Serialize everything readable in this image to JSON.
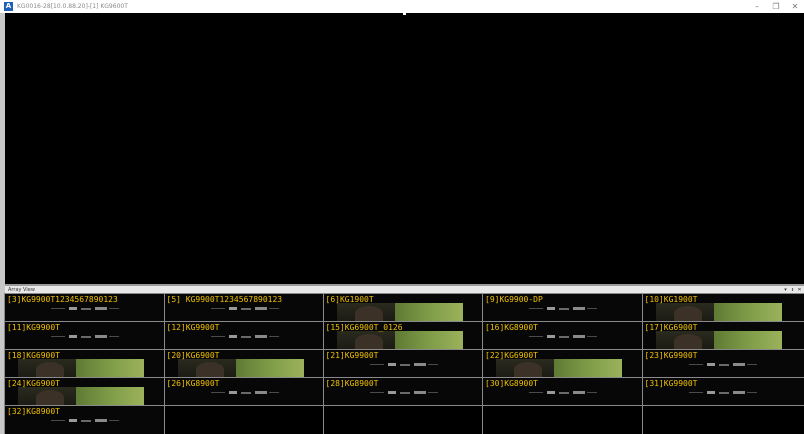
{
  "window": {
    "title": "KG0016-28[10.0.88.20]-[1] KG9600T",
    "app_icon_letter": "A",
    "minimize": "–",
    "maximize": "❐",
    "close": "✕"
  },
  "array_view": {
    "title": "Array View",
    "controls": [
      "▾",
      "ᵻ",
      "✕"
    ]
  },
  "cells": [
    {
      "label": "[3]KG9900T1234567890123",
      "video": false
    },
    {
      "label": "[5] KG9900T1234567890123",
      "video": false
    },
    {
      "label": "[6]KG1900T",
      "video": true
    },
    {
      "label": "[9]KG9900-DP",
      "video": false
    },
    {
      "label": "[10]KG1900T",
      "video": true
    },
    {
      "label": "[11]KG9900T",
      "video": false
    },
    {
      "label": "[12]KG9900T",
      "video": false
    },
    {
      "label": "[15]KG6900T_0126",
      "video": true
    },
    {
      "label": "[16]KG8900T",
      "video": false
    },
    {
      "label": "[17]KG6900T",
      "video": true
    },
    {
      "label": "[18]KG6900T",
      "video": true
    },
    {
      "label": "[20]KG6900T",
      "video": true
    },
    {
      "label": "[21]KG9900T",
      "video": false
    },
    {
      "label": "[22]KG6900T",
      "video": true
    },
    {
      "label": "[23]KG9900T",
      "video": false
    },
    {
      "label": "[24]KG6900T",
      "video": true
    },
    {
      "label": "[26]KG8900T",
      "video": false
    },
    {
      "label": "[28]KG8900T",
      "video": false
    },
    {
      "label": "[30]KG8900T",
      "video": false
    },
    {
      "label": "[31]KG9900T",
      "video": false
    },
    {
      "label": "[32]KG8900T",
      "video": false
    },
    {
      "label": "",
      "video": false,
      "empty": true
    },
    {
      "label": "",
      "video": false,
      "empty": true
    },
    {
      "label": "",
      "video": false,
      "empty": true
    },
    {
      "label": "",
      "video": false,
      "empty": true
    }
  ],
  "colors": {
    "label": "#f2c200",
    "background": "#000000"
  }
}
